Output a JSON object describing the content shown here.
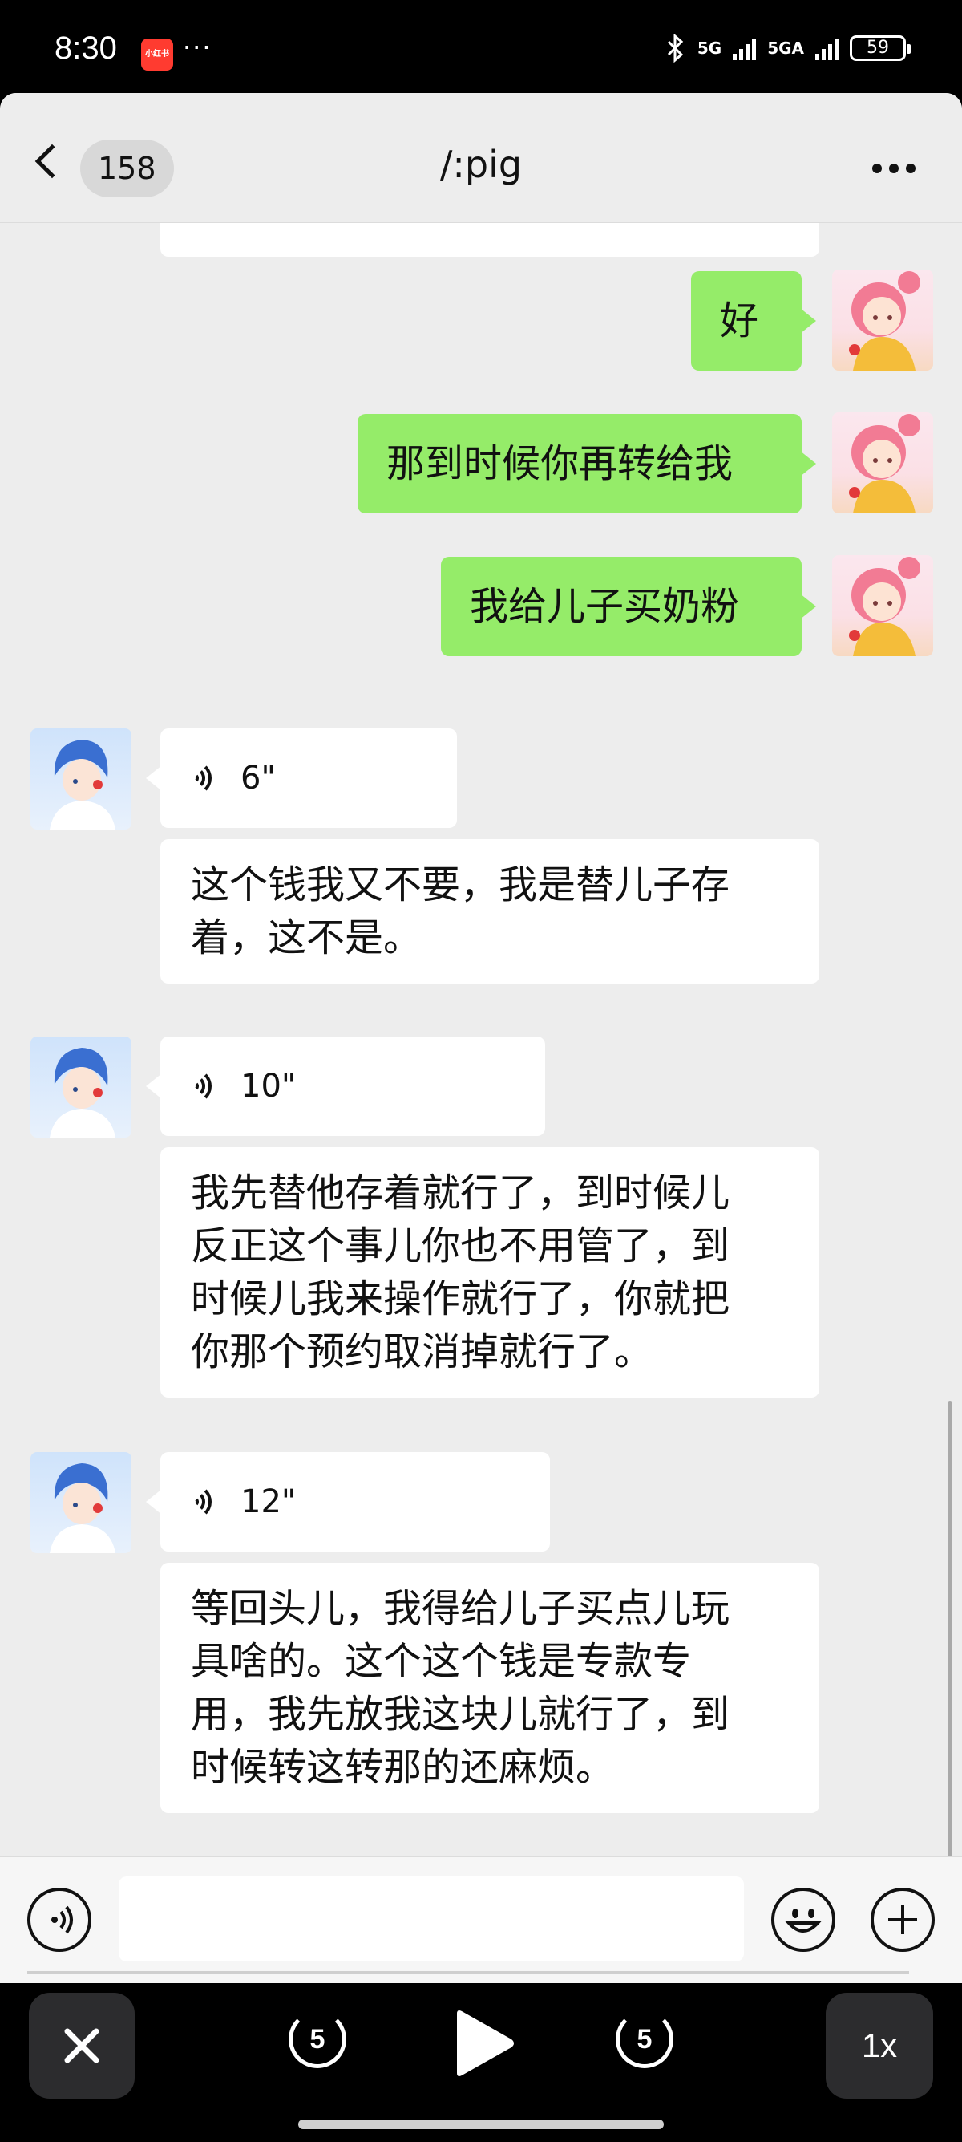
{
  "status_bar": {
    "time": "8:30",
    "app_badge": "小红书",
    "dots": "···",
    "network_1": "5G",
    "network_2": "5GA",
    "battery": "59"
  },
  "header": {
    "back_count": "158",
    "title": "/:pig"
  },
  "messages": [
    {
      "side": "me",
      "text": "好"
    },
    {
      "side": "me",
      "text": "那到时候你再转给我"
    },
    {
      "side": "me",
      "text": "我给儿子买奶粉"
    },
    {
      "side": "them",
      "voice": "6\""
    },
    {
      "side": "them",
      "text_lines": [
        "这个钱我又不要，我是替儿子存",
        "着，这不是。"
      ]
    },
    {
      "side": "them",
      "voice": "10\""
    },
    {
      "side": "them",
      "text_lines": [
        "我先替他存着就行了，到时候儿",
        "反正这个事儿你也不用管了，到",
        "时候儿我来操作就行了，你就把",
        "你那个预约取消掉就行了。"
      ]
    },
    {
      "side": "them",
      "voice": "12\""
    },
    {
      "side": "them",
      "text_lines": [
        "等回头儿，我得给儿子买点儿玩",
        "具啥的。这个这个钱是专款专",
        "用，我先放我这块儿就行了，到",
        "时候转这转那的还麻烦。"
      ]
    }
  ],
  "player": {
    "skip_back": "5",
    "skip_forward": "5",
    "speed": "1x"
  },
  "icons": {
    "back": "chevron-left-icon",
    "more": "more-dots-icon",
    "voice_input": "voice-input-icon",
    "emoji": "emoji-icon",
    "plus": "plus-icon",
    "close": "close-icon",
    "play": "play-icon"
  },
  "colors": {
    "my_bubble": "#95ec69",
    "their_bubble": "#ffffff",
    "chat_bg": "#ededed"
  }
}
